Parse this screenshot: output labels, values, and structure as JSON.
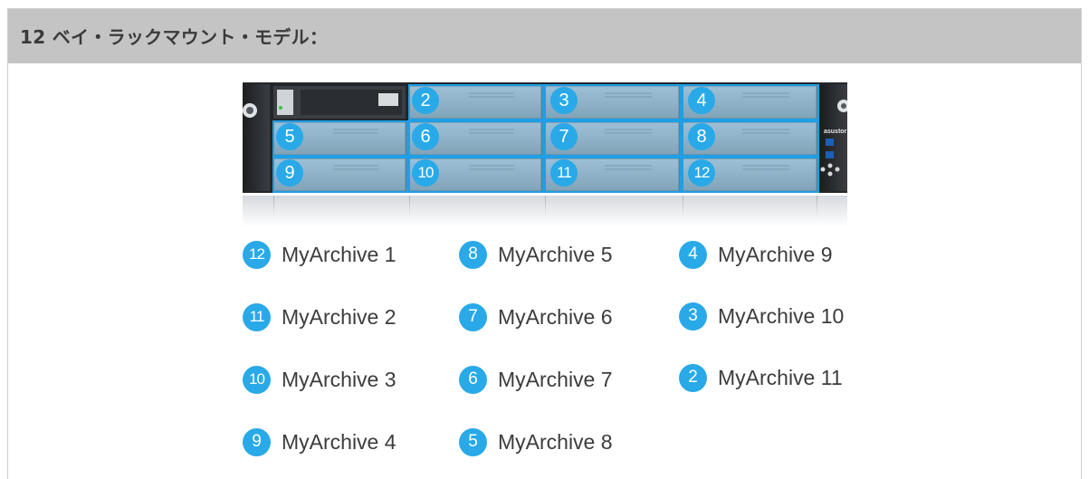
{
  "header": {
    "title": "12 ベイ・ラックマウント・モデル："
  },
  "device": {
    "brand": "asustor",
    "bays": [
      "2",
      "3",
      "4",
      "5",
      "6",
      "7",
      "8",
      "9",
      "10",
      "11",
      "12"
    ]
  },
  "legend": [
    {
      "badge": "12",
      "label": "MyArchive 1"
    },
    {
      "badge": "11",
      "label": "MyArchive 2"
    },
    {
      "badge": "10",
      "label": "MyArchive 3"
    },
    {
      "badge": "9",
      "label": "MyArchive 4"
    },
    {
      "badge": "8",
      "label": "MyArchive 5"
    },
    {
      "badge": "7",
      "label": "MyArchive 6"
    },
    {
      "badge": "6",
      "label": "MyArchive 7"
    },
    {
      "badge": "5",
      "label": "MyArchive 8"
    },
    {
      "badge": "4",
      "label": "MyArchive 9"
    },
    {
      "badge": "3",
      "label": "MyArchive 10"
    },
    {
      "badge": "2",
      "label": "MyArchive 11"
    }
  ],
  "colors": {
    "accent": "#29a9e8",
    "header_bg": "#c4c4c4",
    "bay_highlight": "#8fc9ea"
  }
}
